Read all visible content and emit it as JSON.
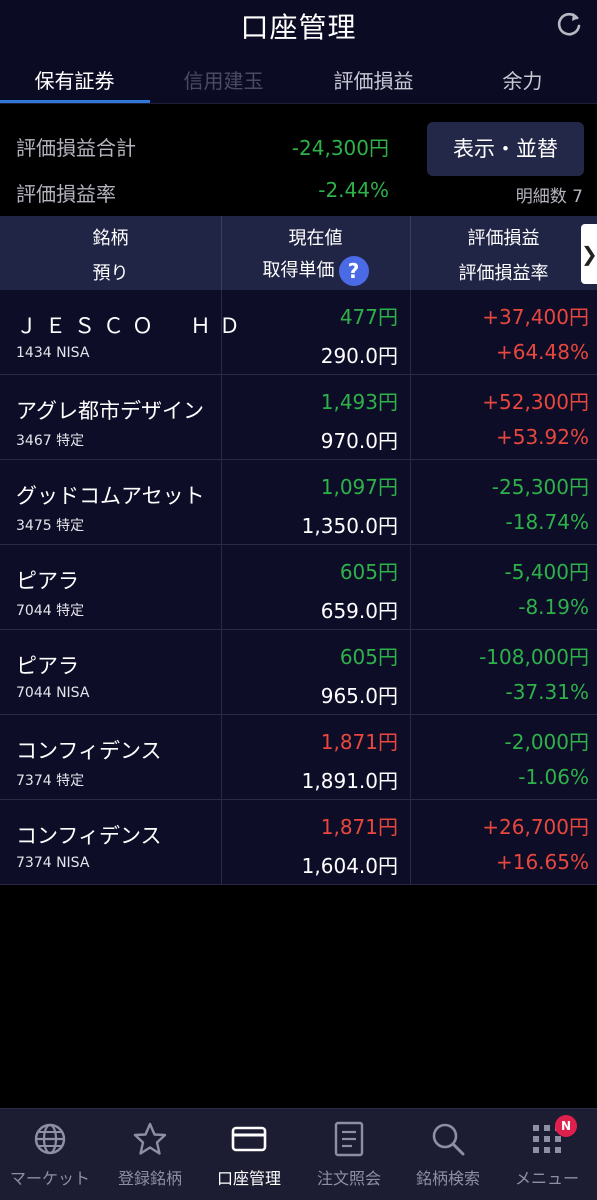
{
  "header": {
    "title": "口座管理",
    "refresh_icon": "refresh-icon"
  },
  "tabs": [
    {
      "label": "保有証券",
      "state": "active"
    },
    {
      "label": "信用建玉",
      "state": "disabled"
    },
    {
      "label": "評価損益",
      "state": "normal"
    },
    {
      "label": "余力",
      "state": "normal"
    }
  ],
  "summary": {
    "total_label": "評価損益合計",
    "total_value": "-24,300円",
    "rate_label": "評価損益率",
    "rate_value": "-2.44%",
    "display_button": "表示・並替",
    "detail_count": "明細数 7"
  },
  "table_header": {
    "col1_top": "銘柄",
    "col1_bottom": "預り",
    "col2_top": "現在値",
    "col2_bottom": "取得単価",
    "col3_top": "評価損益",
    "col3_bottom": "評価損益率",
    "help_icon": "?",
    "scroll_arrow": "❯"
  },
  "holdings": [
    {
      "name": "ＪＥＳＣＯ　ＨＤ",
      "code": "1434 NISA",
      "price": "477円",
      "price_color": "neg",
      "cost": "290.0円",
      "pl": "+37,400円",
      "pl_rate": "+64.48%",
      "pl_color": "pos"
    },
    {
      "name": "アグレ都市デザイン",
      "code": "3467 特定",
      "price": "1,493円",
      "price_color": "neg",
      "cost": "970.0円",
      "pl": "+52,300円",
      "pl_rate": "+53.92%",
      "pl_color": "pos"
    },
    {
      "name": "グッドコムアセット",
      "code": "3475 特定",
      "price": "1,097円",
      "price_color": "neg",
      "cost": "1,350.0円",
      "pl": "-25,300円",
      "pl_rate": "-18.74%",
      "pl_color": "neg"
    },
    {
      "name": "ピアラ",
      "code": "7044 特定",
      "price": "605円",
      "price_color": "neg",
      "cost": "659.0円",
      "pl": "-5,400円",
      "pl_rate": "-8.19%",
      "pl_color": "neg"
    },
    {
      "name": "ピアラ",
      "code": "7044 NISA",
      "price": "605円",
      "price_color": "neg",
      "cost": "965.0円",
      "pl": "-108,000円",
      "pl_rate": "-37.31%",
      "pl_color": "neg"
    },
    {
      "name": "コンフィデンス",
      "code": "7374 特定",
      "price": "1,871円",
      "price_color": "pos",
      "cost": "1,891.0円",
      "pl": "-2,000円",
      "pl_rate": "-1.06%",
      "pl_color": "neg"
    },
    {
      "name": "コンフィデンス",
      "code": "7374 NISA",
      "price": "1,871円",
      "price_color": "pos",
      "cost": "1,604.0円",
      "pl": "+26,700円",
      "pl_rate": "+16.65%",
      "pl_color": "pos"
    }
  ],
  "colors": {
    "positive": "#e8473e",
    "negative": "#2fb14a",
    "accent": "#2f78d6"
  },
  "nav": [
    {
      "label": "マーケット",
      "icon": "globe-icon"
    },
    {
      "label": "登録銘柄",
      "icon": "star-icon"
    },
    {
      "label": "口座管理",
      "icon": "card-icon",
      "active": true
    },
    {
      "label": "注文照会",
      "icon": "document-icon"
    },
    {
      "label": "銘柄検索",
      "icon": "search-icon"
    },
    {
      "label": "メニュー",
      "icon": "grid-icon",
      "badge": "N"
    }
  ]
}
